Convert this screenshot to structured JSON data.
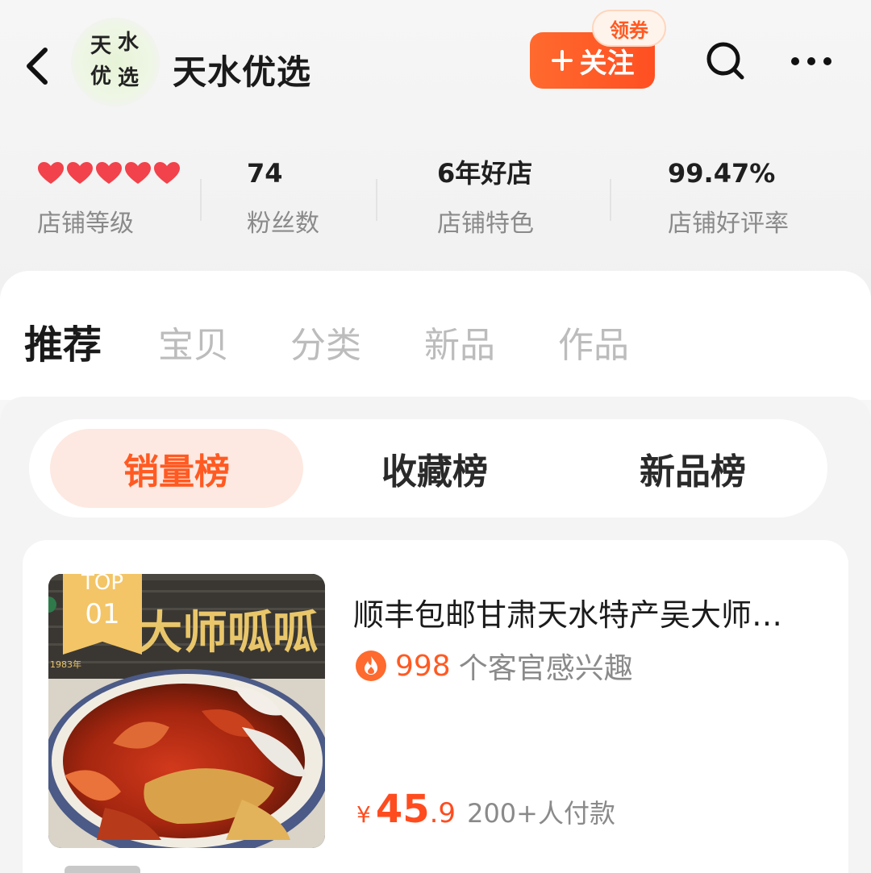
{
  "header": {
    "logo_chars": [
      "天",
      "水",
      "优",
      "选"
    ],
    "store_name": "天水优选",
    "follow_label": "关注",
    "coupon_label": "领券"
  },
  "stats": [
    {
      "value": "",
      "label": "店铺等级",
      "hearts": 5
    },
    {
      "value": "74",
      "label": "粉丝数"
    },
    {
      "value": "6年好店",
      "label": "店铺特色"
    },
    {
      "value": "99.47%",
      "label": "店铺好评率"
    }
  ],
  "tabs": [
    {
      "label": "推荐",
      "active": true
    },
    {
      "label": "宝贝"
    },
    {
      "label": "分类"
    },
    {
      "label": "新品"
    },
    {
      "label": "作品"
    }
  ],
  "rank_tabs": [
    {
      "label": "销量榜",
      "active": true
    },
    {
      "label": "收藏榜"
    },
    {
      "label": "新品榜"
    }
  ],
  "product": {
    "rank_top": "TOP",
    "rank_num": "01",
    "title": "顺丰包邮甘肃天水特产吴大师…",
    "interest_count": "998",
    "interest_text": "个客官感兴趣",
    "price_currency": "¥",
    "price_int": "45",
    "price_dec": ".9",
    "paid_text": "200+人付款",
    "thumb_sign_text": "大师呱呱",
    "thumb_year": "1983年"
  },
  "colors": {
    "accent": "#ff5a22",
    "heart": "#f2424b"
  }
}
